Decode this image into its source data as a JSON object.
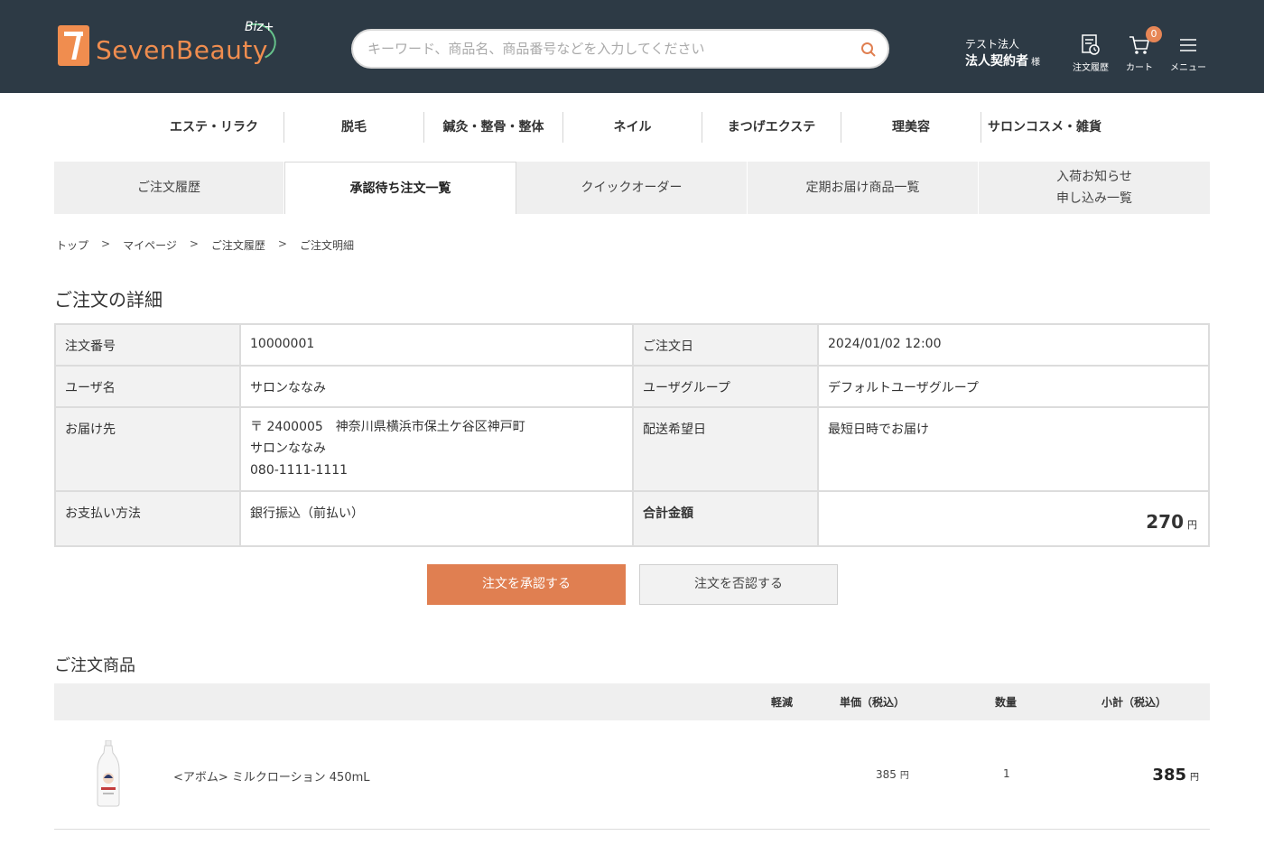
{
  "header": {
    "logo_text": "SevenBeauty",
    "logo_suffix": "Biz+",
    "search_placeholder": "キーワード、商品名、商品番号などを入力してください",
    "user_company": "テスト法人",
    "user_name": "法人契約者",
    "user_suffix": "様",
    "order_history_label": "注文履歴",
    "cart_label": "カート",
    "cart_count": "0",
    "menu_label": "メニュー",
    "colors": {
      "bg": "#2d3a45",
      "accent": "#f08d4f"
    }
  },
  "categories": [
    "エステ・リラク",
    "脱毛",
    "鍼灸・整骨・整体",
    "ネイル",
    "まつげエクステ",
    "理美容",
    "サロンコスメ・雑貨"
  ],
  "tabs": [
    {
      "label": "ご注文履歴",
      "active": false
    },
    {
      "label": "承認待ち注文一覧",
      "active": true
    },
    {
      "label": "クイックオーダー",
      "active": false
    },
    {
      "label": "定期お届け商品一覧",
      "active": false
    },
    {
      "label": "入荷お知らせ\n申し込み一覧",
      "active": false
    }
  ],
  "breadcrumb": [
    "トップ",
    "マイページ",
    "ご注文履歴",
    "ご注文明細"
  ],
  "order_detail": {
    "title": "ご注文の詳細",
    "order_no_label": "注文番号",
    "order_no": "10000001",
    "order_date_label": "ご注文日",
    "order_date": "2024/01/02 12:00",
    "user_name_label": "ユーザ名",
    "user_name": "サロンななみ",
    "user_group_label": "ユーザグループ",
    "user_group": "デフォルトユーザグループ",
    "delivery_label": "お届け先",
    "delivery_address": "〒 2400005　神奈川県横浜市保土ケ谷区神戸町",
    "delivery_name": "サロンななみ",
    "delivery_phone": "080-1111-1111",
    "delivery_date_label": "配送希望日",
    "delivery_date": "最短日時でお届け",
    "payment_label": "お支払い方法",
    "payment": "銀行振込（前払い）",
    "total_label": "合計金額",
    "total": "270",
    "yen": "円"
  },
  "buttons": {
    "approve": "注文を承認する",
    "reject": "注文を否認する"
  },
  "products": {
    "title": "ご注文商品",
    "headers": {
      "reduced": "軽減",
      "unit_price": "単価（税込）",
      "qty": "数量",
      "subtotal": "小計（税込）"
    },
    "items": [
      {
        "name": "<アボム> ミルクローション 450mL",
        "unit_price": "385",
        "qty": "1",
        "subtotal": "385"
      }
    ],
    "yen": "円"
  }
}
